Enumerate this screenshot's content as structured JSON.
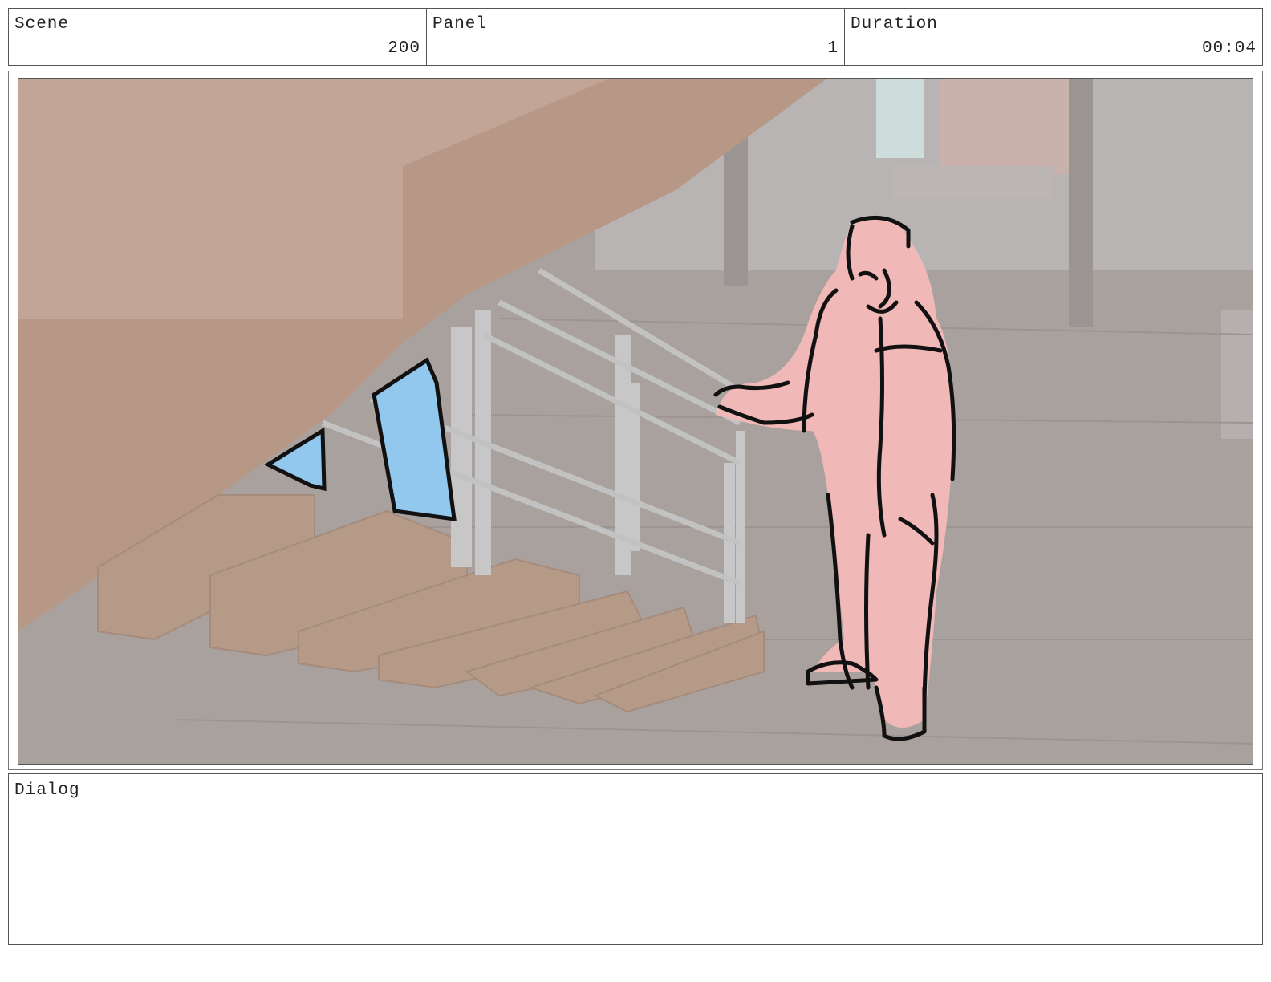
{
  "header": {
    "scene": {
      "label": "Scene",
      "value": "200"
    },
    "panel": {
      "label": "Panel",
      "value": "1"
    },
    "duration": {
      "label": "Duration",
      "value": "00:04"
    }
  },
  "frame": {
    "description_icon": "storyboard-sketch",
    "colors": {
      "background": "#a8a09c",
      "stairs": "#b89786",
      "character": "#f0b8b6",
      "window": "#92c8ee",
      "ink": "#111111"
    }
  },
  "dialog": {
    "label": "Dialog",
    "text": ""
  }
}
